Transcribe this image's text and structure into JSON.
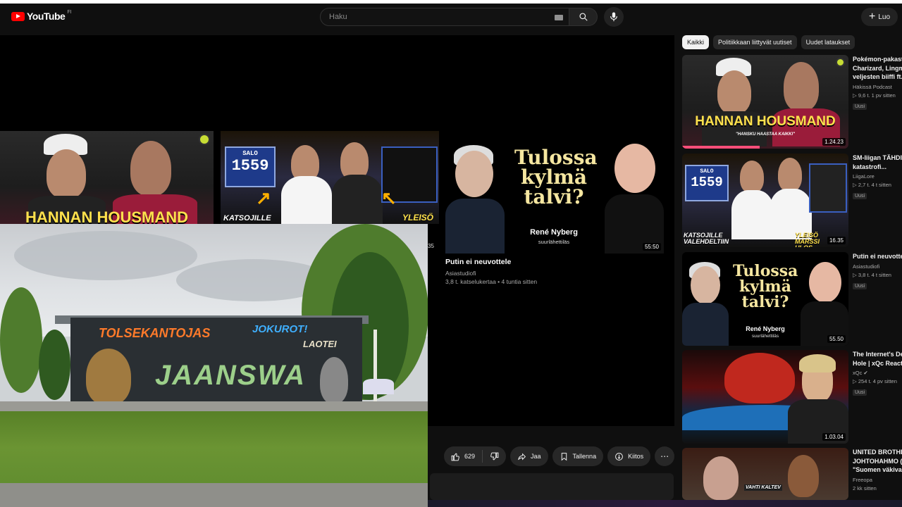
{
  "header": {
    "logo_text": "YouTube",
    "region": "FI",
    "search_placeholder": "Haku",
    "create_label": "Luo"
  },
  "player": {
    "strip_videos": [
      {
        "title_overlay": "HANNAN HOUSMAND"
      },
      {
        "scoreboard_label": "SALO",
        "score": "1559",
        "caption_left": "KATSOJILLE",
        "caption_right": "YLEISÖ"
      },
      {
        "title_overlay": "Tulossa kylmä talvi?",
        "guest_name": "René Nyberg",
        "guest_role": "suurlähettiläs",
        "duration": "55:50",
        "partial_duration": "35"
      }
    ],
    "featured": {
      "title": "Putin ei neuvottele",
      "channel": "Asiastudiofi",
      "meta": "3,8 t. katselukertaa • 4 tuntia sitten"
    },
    "graffiti": {
      "line1": "TOLSEKANTOJAS",
      "line2": "JOKUROT!",
      "line3": "LAOTEI",
      "main": "JAANSWA"
    }
  },
  "actions": {
    "like_count": "629",
    "share_label": "Jaa",
    "save_label": "Tallenna",
    "thanks_label": "Kiitos",
    "more_label": "⋯"
  },
  "chips": [
    {
      "label": "Kaikki",
      "active": true
    },
    {
      "label": "Politiikkaan liittyvät uutiset",
      "active": false
    },
    {
      "label": "Uudet lataukset",
      "active": false
    }
  ],
  "recommendations": [
    {
      "title_lines": [
        "Pokémon-pakast",
        "Charizard, Lingm",
        "veljesten biiffi ft."
      ],
      "channel": "Häkissä Podcast",
      "meta": "▷ 9,6 t.   1 pv sitten",
      "badge": "Uusi",
      "duration": "1.24.23",
      "thumb_title": "HANNAN HOUSMAND",
      "thumb_sub": "\"HANSKU HAASTAA KAIKKI\""
    },
    {
      "title_lines": [
        "SM-liigan TÄHDIS",
        "katastrofi..."
      ],
      "channel": "LiigaLore",
      "meta": "▷ 2,7 t.   4 t sitten",
      "badge": "Uusi",
      "duration": "16.35",
      "thumb_scoreboard": "SALO",
      "thumb_score": "1559",
      "thumb_caption_left": "KATSOJILLE VALEHDELTIIN",
      "thumb_caption_right": "YLEISÖ MARSSI ULOS"
    },
    {
      "title_lines": [
        "Putin ei neuvottele"
      ],
      "channel": "Asiastudiofi",
      "meta": "▷ 3,8 t.   4 t sitten",
      "badge": "Uusi",
      "duration": "55.50",
      "thumb_title": "Tulossa kylmä talvi?",
      "thumb_name": "René Nyberg",
      "thumb_role": "suurlähettiläs"
    },
    {
      "title_lines": [
        "The Internet's De",
        "Hole | xQc React"
      ],
      "channel": "xQc ✔",
      "meta": "▷ 254 t.   4 pv sitten",
      "badge": "Uusi",
      "duration": "1.03.04"
    },
    {
      "title_lines": [
        "UNITED BROTHE",
        "JOHTOHAHMO (",
        "\"Suomen väkivalt"
      ],
      "channel": "Freeopa",
      "meta": "2 kk sitten",
      "thumb_label": "VAHTI KALTEV"
    }
  ],
  "colors": {
    "background": "#0f0f0f",
    "youtube_red": "#ff0000",
    "chip_active": "#f1f1f1",
    "title_yellow": "#ffe14d"
  }
}
